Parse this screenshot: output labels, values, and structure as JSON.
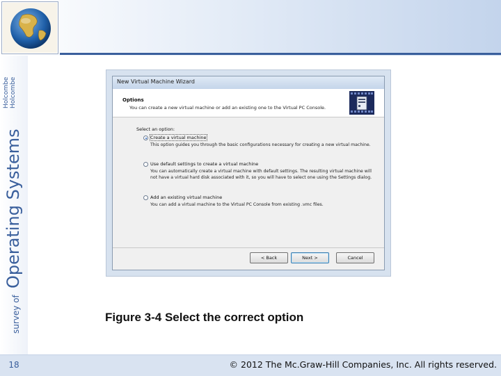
{
  "branding": {
    "series_prefix": "survey of",
    "series_title": "Operating Systems",
    "authors": [
      "Holcombe",
      "Holcombe"
    ]
  },
  "dialog": {
    "title": "New Virtual Machine Wizard",
    "header_title": "Options",
    "header_subtitle": "You can create a new virtual machine or add an existing one to the Virtual PC Console.",
    "select_label": "Select an option:",
    "options": [
      {
        "label": "Create a virtual machine",
        "selected": true,
        "description": "This option guides you through the basic configurations necessary for creating a new virtual machine."
      },
      {
        "label": "Use default settings to create a virtual machine",
        "selected": false,
        "description": "You can automatically create a virtual machine with default settings. The resulting virtual machine will not have a virtual hard disk associated with it, so you will have to select one using the Settings dialog."
      },
      {
        "label": "Add an existing virtual machine",
        "selected": false,
        "description": "You can add a virtual machine to the Virtual PC Console from existing .vmc files."
      }
    ],
    "buttons": {
      "back": "< Back",
      "next": "Next >",
      "cancel": "Cancel"
    }
  },
  "caption": "Figure 3-4 Select the correct option",
  "footer": {
    "page_number": "18",
    "copyright": "© 2012 The Mc.Graw-Hill Companies, Inc. All rights reserved."
  },
  "colors": {
    "accent": "#3a5f9c",
    "footer_bg": "#d9e3f1"
  }
}
